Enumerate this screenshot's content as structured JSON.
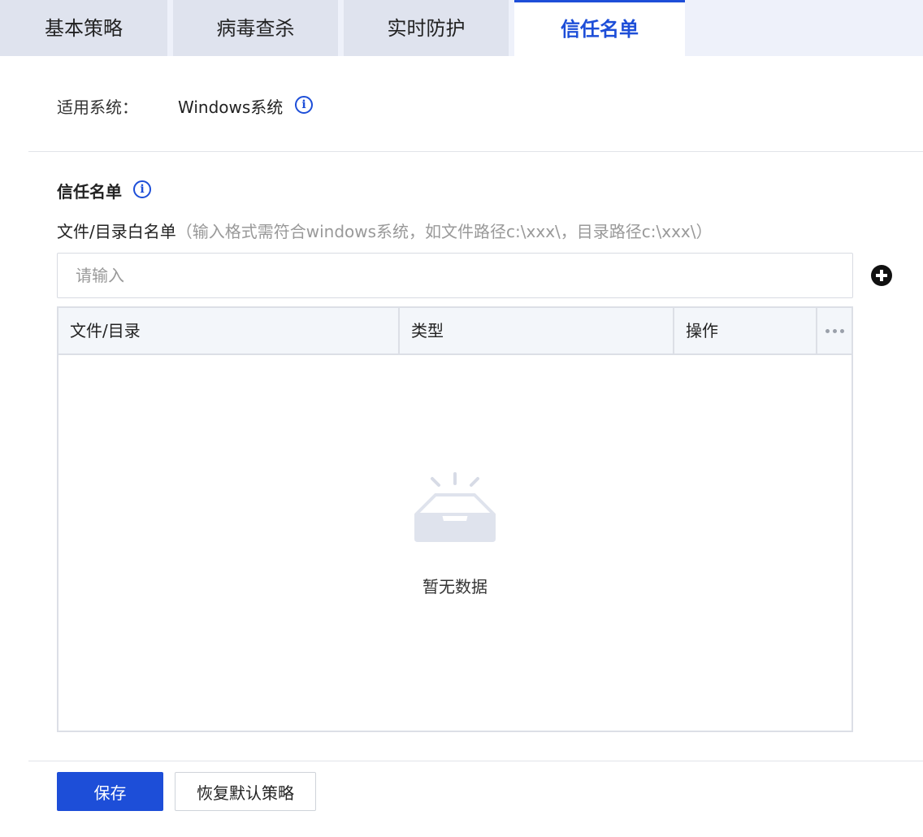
{
  "tabs": [
    {
      "label": "基本策略",
      "active": false
    },
    {
      "label": "病毒查杀",
      "active": false
    },
    {
      "label": "实时防护",
      "active": false
    },
    {
      "label": "信任名单",
      "active": true
    }
  ],
  "os": {
    "label": "适用系统：",
    "value": "Windows系统"
  },
  "trust_section": {
    "title": "信任名单",
    "whitelist_label": "文件/目录白名单",
    "whitelist_hint": "（输入格式需符合windows系统，如文件路径c:\\xxx\\，目录路径c:\\xxx\\）",
    "input_placeholder": "请输入",
    "input_value": ""
  },
  "table": {
    "columns": [
      "文件/目录",
      "类型",
      "操作"
    ],
    "rows": [],
    "empty_text": "暂无数据"
  },
  "footer": {
    "save_label": "保存",
    "restore_label": "恢复默认策略"
  },
  "colors": {
    "primary": "#1d4ed8",
    "tab_inactive_bg": "#dfe3ee",
    "header_bg": "#f3f6fa"
  }
}
